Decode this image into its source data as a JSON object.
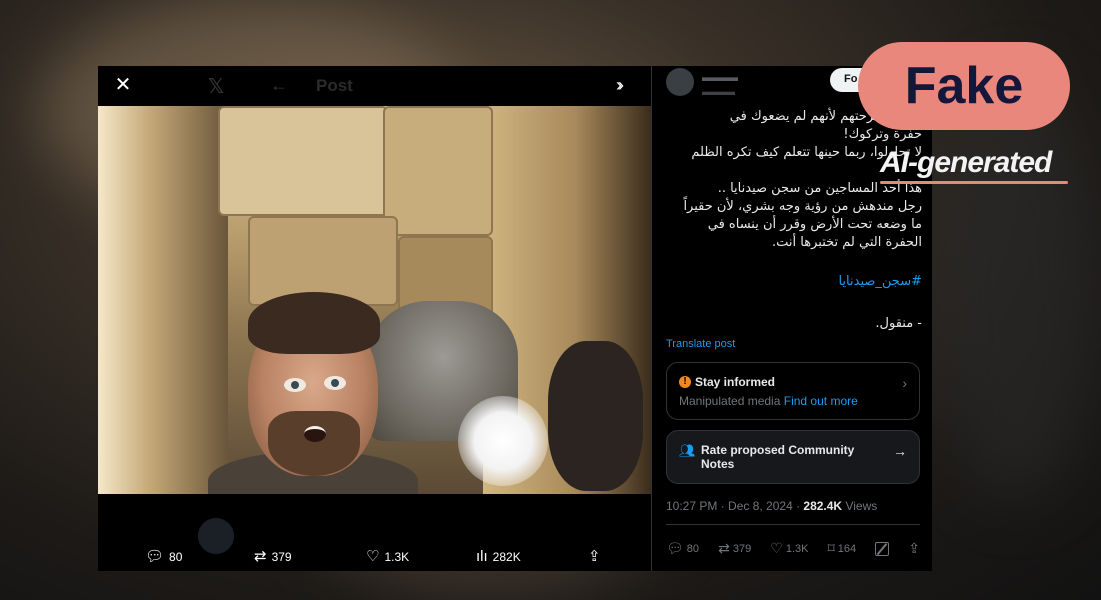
{
  "colors": {
    "accent": "#1d9bf0",
    "stamp": "#e9877d",
    "warning": "#f4891f",
    "stamp_text": "#14163a"
  },
  "viewer": {
    "title": "Post",
    "icons": {
      "close": "close-icon",
      "logo": "x-logo-icon",
      "back": "back-arrow-icon",
      "expand": "expand-icon"
    },
    "metrics": {
      "replies": "80",
      "reposts": "379",
      "likes": "1.3K",
      "views": "282K"
    }
  },
  "post": {
    "follow_label": "Fo",
    "text": "قهرتهم فرحتهم لأنهم لم يضعوك في\nحفرة وتركوك!\nلا تحاولوا، ربما حينها تتعلم كيف تكره الظلم\n\nهذا أحد المساجين من سجن صيدنايا ..\nرجل مندهش من رؤية وجه بشري، لأن حقيراً\nما وضعه تحت الأرض وقرر أن ينساه في\nالحفرة التي لم تختبرها أنت.",
    "hashtag": "#سجن_صيدنايا",
    "naqool": "- منقول.",
    "translate_label": "Translate post",
    "stay_informed": {
      "heading": "Stay informed",
      "sub": "Manipulated media",
      "link": "Find out more"
    },
    "community_notes": {
      "label": "Rate proposed Community Notes"
    },
    "timestamp": "10:27 PM · Dec 8, 2024 · ",
    "views_count": "282.4K",
    "views_label": " Views",
    "actions": {
      "replies": "80",
      "reposts": "379",
      "likes": "1.3K",
      "bookmarks": "164"
    }
  },
  "stamp": {
    "verdict": "Fake",
    "reason": "AI-generated"
  }
}
